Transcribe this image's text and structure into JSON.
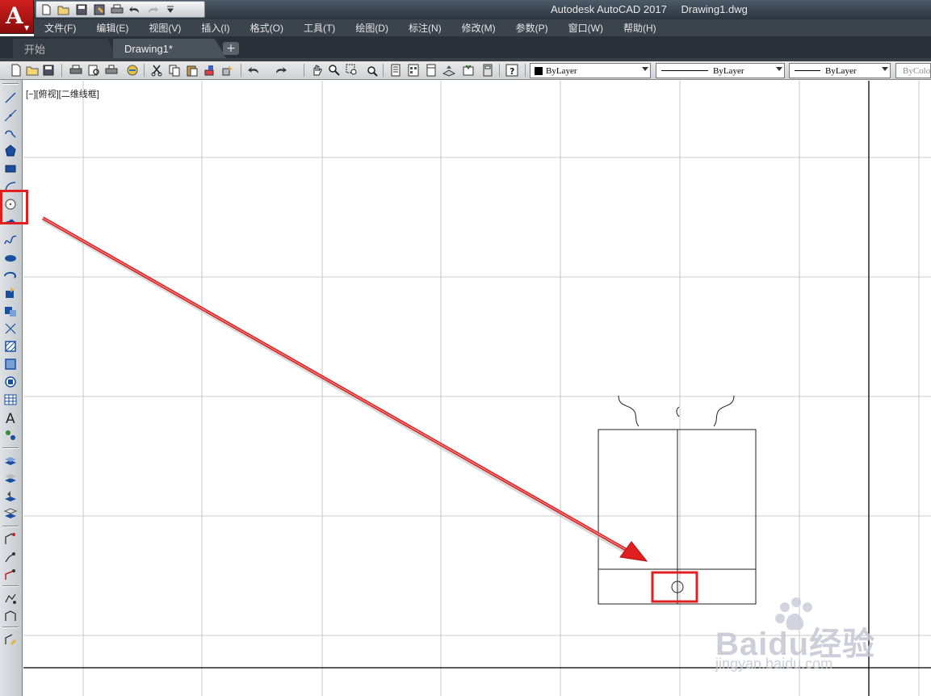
{
  "titlebar": {
    "app_name": "Autodesk AutoCAD 2017",
    "document": "Drawing1.dwg",
    "logo_letter": "A"
  },
  "menu": [
    "文件(F)",
    "编辑(E)",
    "视图(V)",
    "插入(I)",
    "格式(O)",
    "工具(T)",
    "绘图(D)",
    "标注(N)",
    "修改(M)",
    "参数(P)",
    "窗口(W)",
    "帮助(H)"
  ],
  "tabs": {
    "start": "开始",
    "drawing": "Drawing1*",
    "add": "+"
  },
  "properties": {
    "color": "ByLayer",
    "linetype": "ByLayer",
    "lineweight": "ByLayer",
    "plotstyle": "ByColor"
  },
  "viewport": {
    "label": "[−][俯视][二维线框]"
  },
  "watermark": {
    "brand": "Baidu经验",
    "url": "jingyan.baidu.com"
  },
  "colors": {
    "highlight": "#e02020",
    "dark_ui": "#3b434c"
  },
  "icons": {
    "highlighted_tool": "circle-icon"
  }
}
